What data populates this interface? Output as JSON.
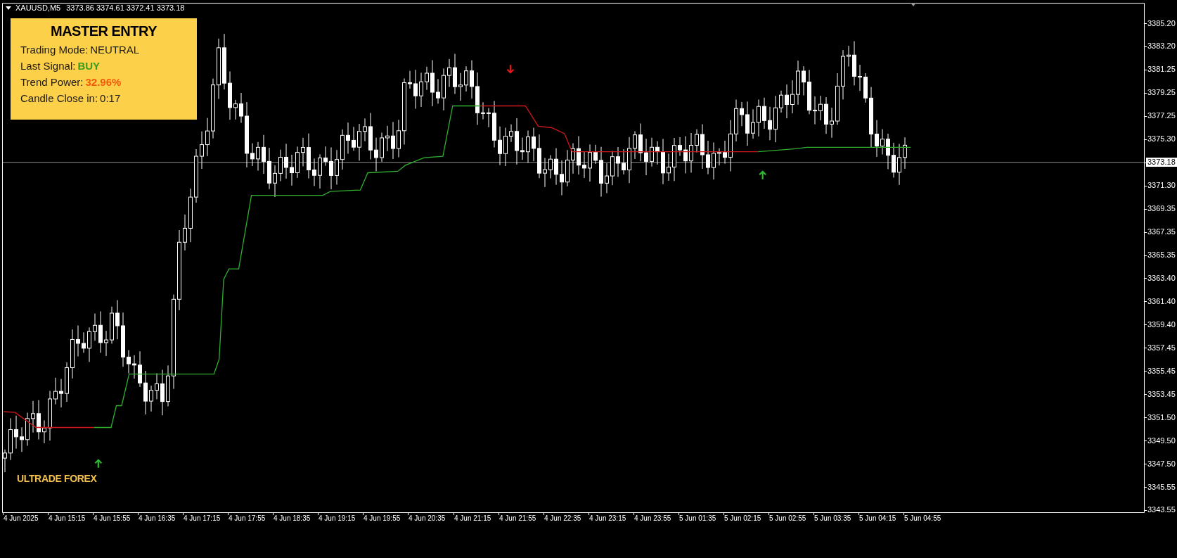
{
  "chart": {
    "header": {
      "symbol": "XAUUSD,M5",
      "prices": "3373.86 3374.61 3372.41 3373.18"
    },
    "price_labels": [
      {
        "text": "3385.20",
        "current": false
      },
      {
        "text": "3383.20",
        "current": false
      },
      {
        "text": "3381.25",
        "current": false
      },
      {
        "text": "3379.25",
        "current": false
      },
      {
        "text": "3377.25",
        "current": false
      },
      {
        "text": "3375.30",
        "current": false
      },
      {
        "text": "3373.18",
        "current": true
      },
      {
        "text": "3371.30",
        "current": false
      },
      {
        "text": "3369.35",
        "current": false
      },
      {
        "text": "3367.35",
        "current": false
      },
      {
        "text": "3365.35",
        "current": false
      },
      {
        "text": "3363.40",
        "current": false
      },
      {
        "text": "3361.40",
        "current": false
      },
      {
        "text": "3359.40",
        "current": false
      },
      {
        "text": "3357.45",
        "current": false
      },
      {
        "text": "3355.45",
        "current": false
      },
      {
        "text": "3353.45",
        "current": false
      },
      {
        "text": "3351.50",
        "current": false
      },
      {
        "text": "3349.50",
        "current": false
      },
      {
        "text": "3347.50",
        "current": false
      },
      {
        "text": "3345.55",
        "current": false
      },
      {
        "text": "3343.55",
        "current": false
      }
    ],
    "time_labels": [
      "4 Jun 2025",
      "4 Jun 15:15",
      "4 Jun 15:55",
      "4 Jun 16:35",
      "4 Jun 17:15",
      "4 Jun 17:55",
      "4 Jun 18:35",
      "4 Jun 19:15",
      "4 Jun 19:55",
      "4 Jun 20:35",
      "4 Jun 21:15",
      "4 Jun 21:55",
      "4 Jun 22:35",
      "4 Jun 23:15",
      "4 Jun 23:55",
      "5 Jun 01:35",
      "5 Jun 02:15",
      "5 Jun 02:55",
      "5 Jun 03:35",
      "5 Jun 04:15",
      "5 Jun 04:55"
    ],
    "brand_label": "ULTRADE FOREX"
  },
  "panel": {
    "title": "MASTER ENTRY",
    "rows": [
      {
        "label": "Trading Mode:",
        "value": "NEUTRAL",
        "kind": "plain"
      },
      {
        "label": "Last Signal:",
        "value": "BUY",
        "kind": "highlight",
        "color": "#3a9a1c"
      },
      {
        "label": "Trend Power:",
        "value": "32.96%",
        "kind": "highlight",
        "color": "#f25a0c"
      },
      {
        "label": "Candle Close in:",
        "value": "0:17",
        "kind": "plain"
      }
    ]
  }
}
